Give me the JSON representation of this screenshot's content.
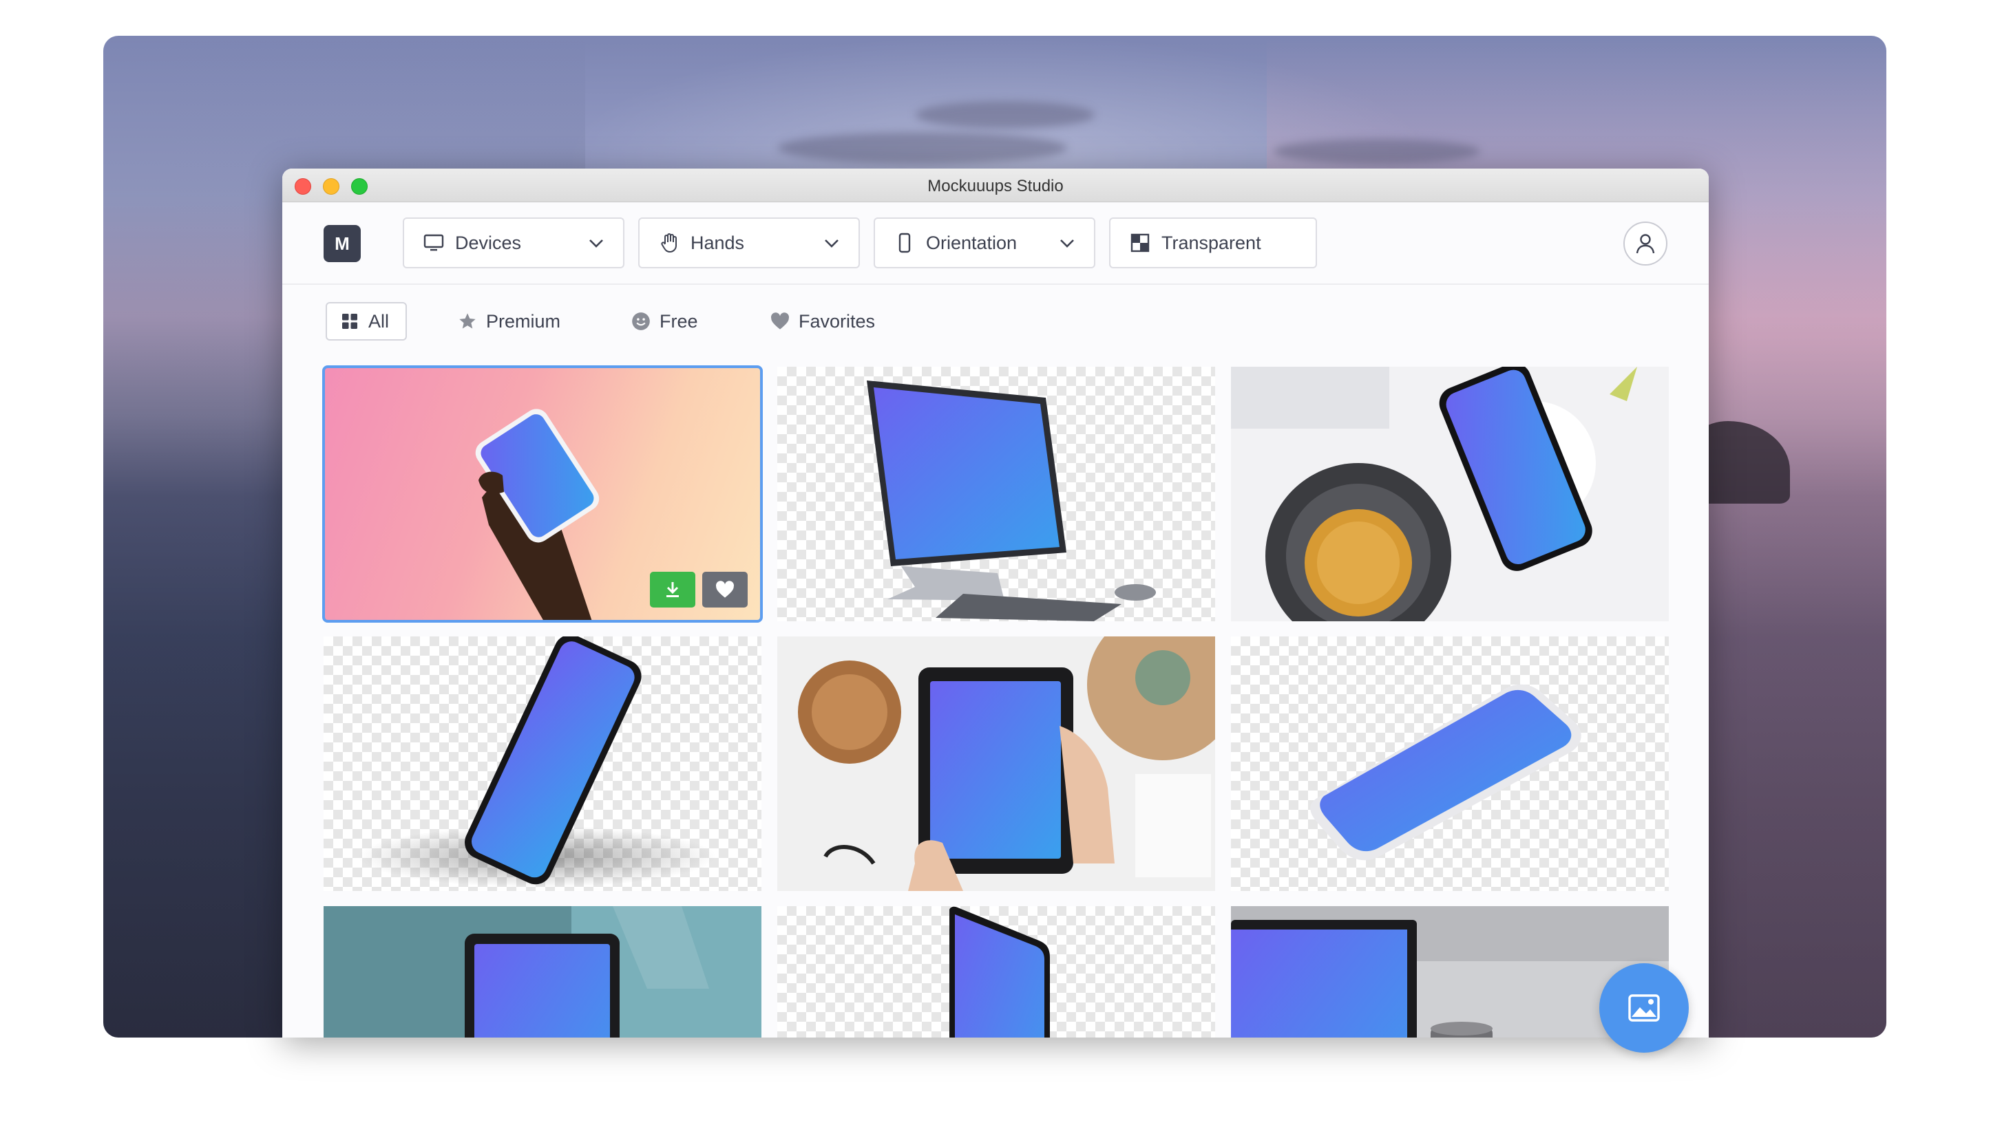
{
  "window": {
    "title": "Mockuuups Studio"
  },
  "toolbar": {
    "logo_letter": "M",
    "filters": [
      {
        "label": "Devices",
        "icon": "monitor-icon"
      },
      {
        "label": "Hands",
        "icon": "hand-icon"
      },
      {
        "label": "Orientation",
        "icon": "phone-portrait-icon"
      },
      {
        "label": "Transparent",
        "icon": "checkerboard-icon"
      }
    ],
    "account_icon": "user-icon"
  },
  "tabs": [
    {
      "label": "All",
      "icon": "grid-icon",
      "active": true
    },
    {
      "label": "Premium",
      "icon": "star-icon"
    },
    {
      "label": "Free",
      "icon": "smiley-icon"
    },
    {
      "label": "Favorites",
      "icon": "heart-icon"
    }
  ],
  "mockups": [
    {
      "subject": "hand holding phone",
      "background": "pink-gradient",
      "selected": true
    },
    {
      "subject": "all-in-one desktop computer",
      "background": "transparent"
    },
    {
      "subject": "phone beside coffee cup",
      "background": "white desk"
    },
    {
      "subject": "tilted phone",
      "background": "transparent"
    },
    {
      "subject": "hands holding tablet",
      "background": "white desk"
    },
    {
      "subject": "phone lying flat",
      "background": "transparent"
    },
    {
      "subject": "tablet on teal wall",
      "background": "teal"
    },
    {
      "subject": "phone upright",
      "background": "transparent"
    },
    {
      "subject": "laptop on grey desk",
      "background": "grey"
    }
  ],
  "card_actions": {
    "download_icon": "download-icon",
    "favorite_icon": "heart-icon",
    "download_color": "#3cb84a",
    "favorite_color": "#6b6e76"
  },
  "fab": {
    "icon": "image-icon",
    "color": "#4d95ee"
  },
  "colors": {
    "accent": "#5c9df0"
  }
}
